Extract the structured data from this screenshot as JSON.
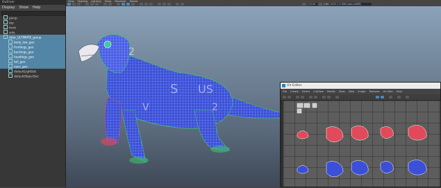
{
  "outliner": {
    "title": "Outliner",
    "menu": [
      "Display",
      "Show",
      "Help"
    ],
    "items": [
      {
        "label": "persp",
        "selected": false
      },
      {
        "label": "top",
        "selected": false
      },
      {
        "label": "front",
        "selected": false
      },
      {
        "label": "side",
        "selected": false
      },
      {
        "label": "otter_ULTIMATE_group",
        "selected": true
      },
      {
        "label": "body_low_geo",
        "selected": true
      },
      {
        "label": "frontlegs_geo",
        "selected": true
      },
      {
        "label": "backlegs_geo",
        "selected": true
      },
      {
        "label": "headlegs_geo",
        "selected": true
      },
      {
        "label": "tail_geo",
        "selected": true
      },
      {
        "label": "eyes_geo",
        "selected": true
      },
      {
        "label": "defaultLightSet",
        "selected": false
      },
      {
        "label": "defaultObjectSet",
        "selected": false
      }
    ]
  },
  "viewport": {
    "menu": [
      "View",
      "Shading",
      "Lighting",
      "Show",
      "Renderer",
      "Panels"
    ],
    "value_a": "0.00",
    "value_b": "1.00",
    "color_space": "ACES 1.0 SDR-video (sRGB)"
  },
  "uv_editor": {
    "title": "UV Editor",
    "menu": [
      "File",
      "Create",
      "Select",
      "Cut/Sew",
      "Modify",
      "Tools",
      "View",
      "Image",
      "Textures",
      "UV Sets",
      "Help"
    ]
  },
  "colors": {
    "accent": "#5285a6",
    "mesh_blue": "#3c4fd8",
    "wire_green": "#3ec96a",
    "uv_red": "#e04a5a"
  }
}
